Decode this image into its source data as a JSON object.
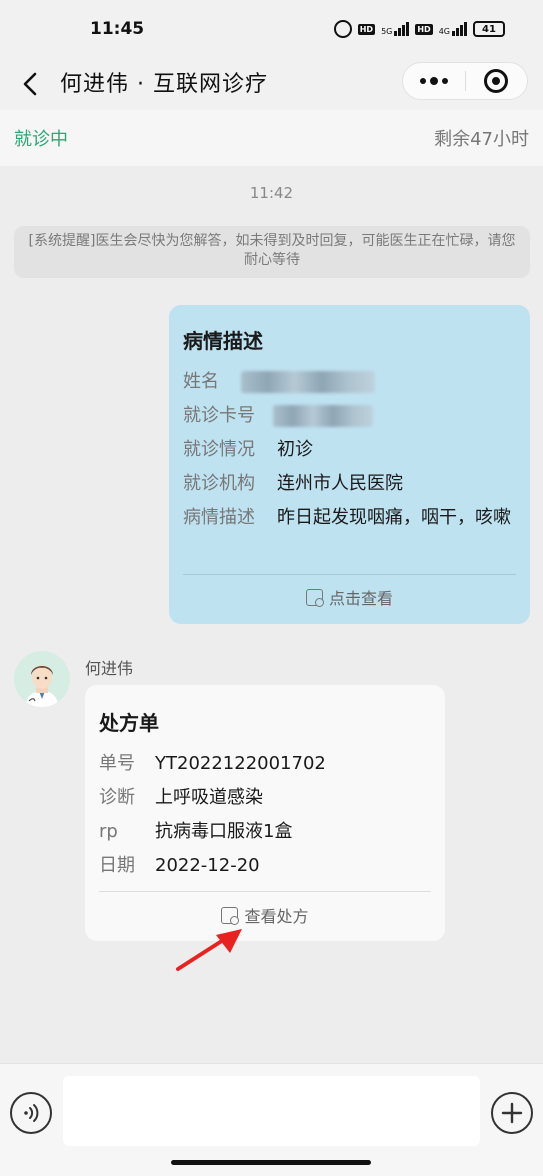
{
  "status_bar": {
    "time": "11:45",
    "hd1": "HD",
    "net1": "5G",
    "hd2": "HD",
    "net2": "4G",
    "battery": "41"
  },
  "nav": {
    "title": "何进伟 · 互联网诊疗"
  },
  "consult": {
    "status": "就诊中",
    "remaining": "剩余47小时"
  },
  "chat": {
    "time": "11:42",
    "system_notice": "[系统提醒]医生会尽快为您解答，如未得到及时回复，可能医生正在忙碌，请您耐心等待"
  },
  "description_card": {
    "title": "病情描述",
    "name_label": "姓名",
    "card_no_label": "就诊卡号",
    "visit_type_label": "就诊情况",
    "visit_type_value": "初诊",
    "institution_label": "就诊机构",
    "institution_value": "连州市人民医院",
    "symptom_label": "病情描述",
    "symptom_value": "昨日起发现咽痛，咽干，咳嗽",
    "footer": "点击查看"
  },
  "doctor": {
    "name": "何进伟"
  },
  "prescription_card": {
    "title": "处方单",
    "rows": [
      {
        "key": "单号",
        "value": "YT2022122001702"
      },
      {
        "key": "诊断",
        "value": "上呼吸道感染"
      },
      {
        "key": "rp",
        "value": "抗病毒口服液1盒"
      },
      {
        "key": "日期",
        "value": "2022-12-20"
      }
    ],
    "footer": "查看处方"
  },
  "colors": {
    "accent_green": "#2aa872",
    "patient_bubble": "#bfe2f1",
    "annotation_red": "#e8231f"
  }
}
